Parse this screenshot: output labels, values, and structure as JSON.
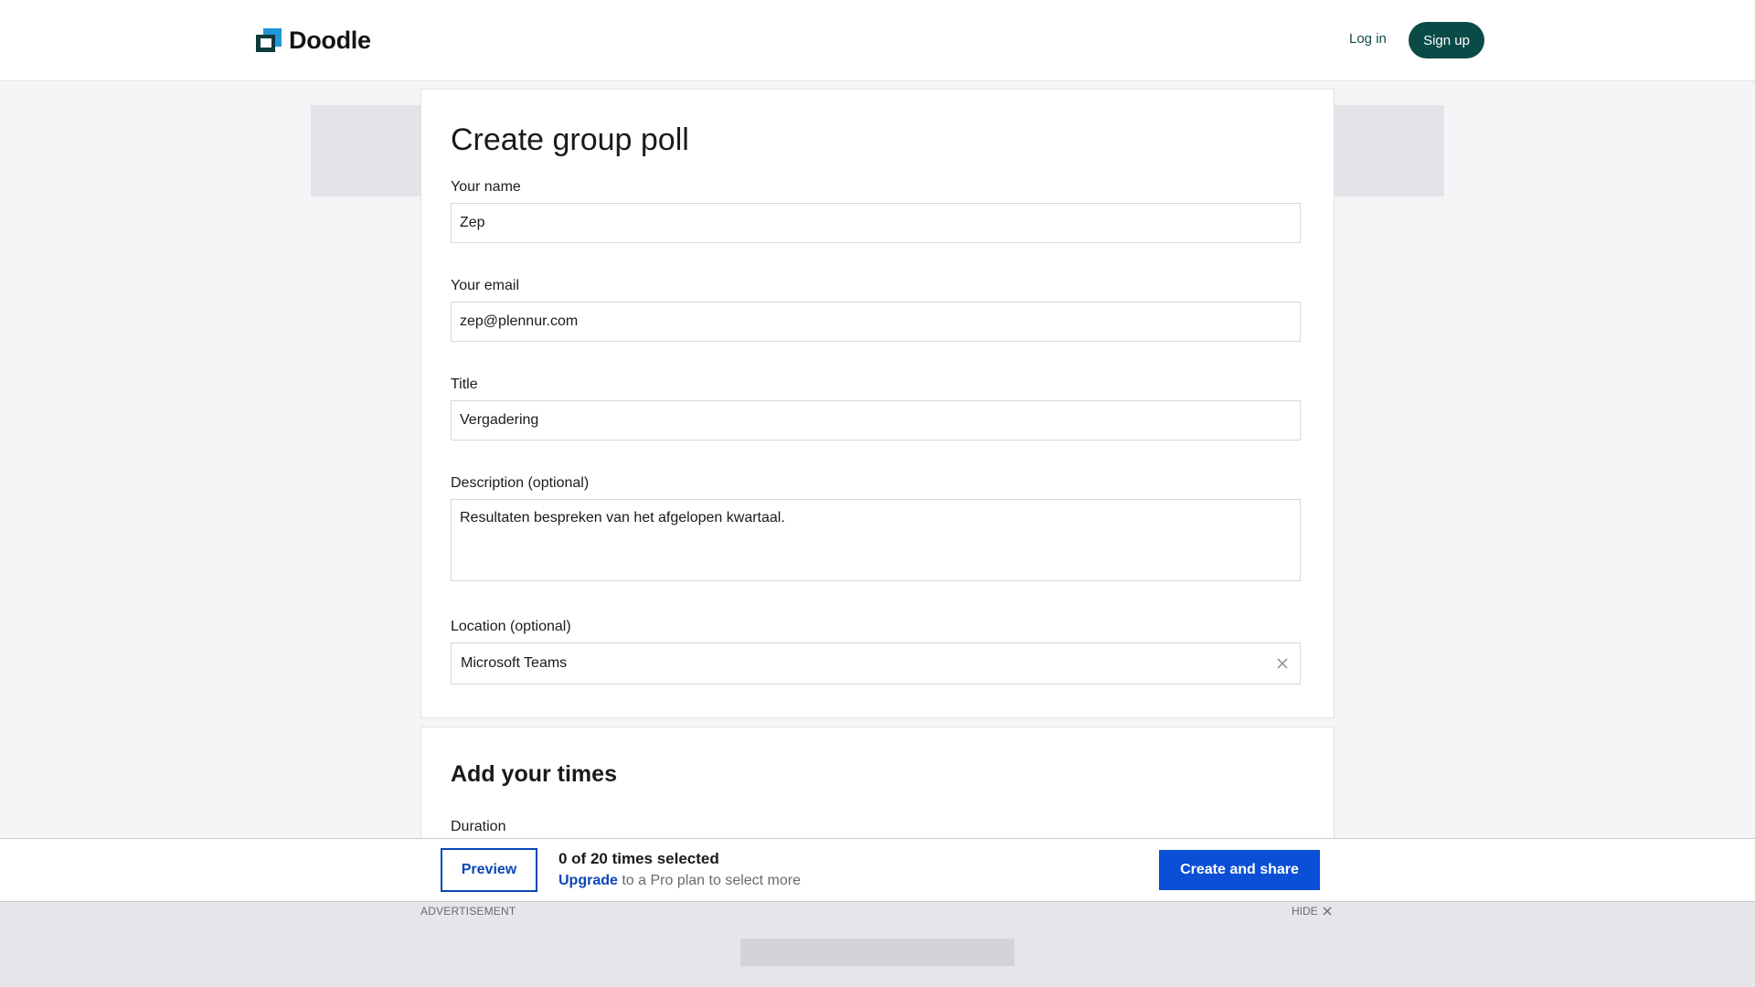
{
  "header": {
    "brand": "Doodle",
    "login_label": "Log in",
    "signup_label": "Sign up"
  },
  "form": {
    "title": "Create group poll",
    "name_label": "Your name",
    "name_value": "Zep",
    "email_label": "Your email",
    "email_value": "zep@plennur.com",
    "title_label": "Title",
    "title_value": "Vergadering",
    "description_label": "Description (optional)",
    "description_value": "Resultaten bespreken van het afgelopen kwartaal.",
    "location_label": "Location (optional)",
    "location_value": "Microsoft Teams"
  },
  "times": {
    "title": "Add your times",
    "duration_label": "Duration"
  },
  "action_bar": {
    "preview_label": "Preview",
    "selected_count": "0 of 20 times selected",
    "upgrade_link": "Upgrade",
    "upgrade_suffix": " to a Pro plan to select more",
    "create_label": "Create and share"
  },
  "ad": {
    "label": "ADVERTISEMENT",
    "hide_label": "HIDE"
  },
  "colors": {
    "brand_teal": "#0b4b47",
    "primary_blue": "#0b4fd6",
    "logo_blue": "#2196d9"
  }
}
